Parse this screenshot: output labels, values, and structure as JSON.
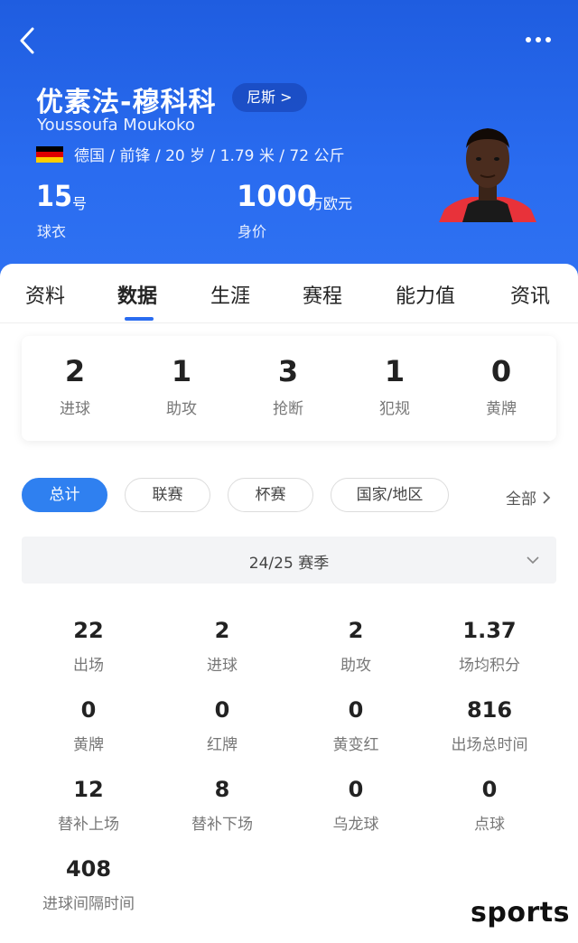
{
  "header": {
    "name_cn": "优素法-穆科科",
    "club": "尼斯 >",
    "name_en": "Youssoufa Moukoko",
    "info": "德国 / 前锋 / 20 岁 / 1.79 米 / 72 公斤",
    "jersey_number": "15",
    "jersey_unit": "号",
    "jersey_label": "球衣",
    "market_value": "1000",
    "market_value_unit": "万欧元",
    "market_value_label": "身价",
    "flag_colors": [
      "#000000",
      "#dd0000",
      "#ffce00"
    ],
    "brand_color": "#2a6cf0"
  },
  "tabs": [
    "资料",
    "数据",
    "生涯",
    "赛程",
    "能力值",
    "资讯"
  ],
  "active_tab": "数据",
  "summary": [
    {
      "value": "2",
      "label": "进球"
    },
    {
      "value": "1",
      "label": "助攻"
    },
    {
      "value": "3",
      "label": "抢断"
    },
    {
      "value": "1",
      "label": "犯规"
    },
    {
      "value": "0",
      "label": "黄牌"
    }
  ],
  "filters": [
    "总计",
    "联赛",
    "杯赛",
    "国家/地区"
  ],
  "active_filter": "总计",
  "filter_all": "全部",
  "season": "24/25 赛季",
  "stats": [
    {
      "value": "22",
      "label": "出场"
    },
    {
      "value": "2",
      "label": "进球"
    },
    {
      "value": "2",
      "label": "助攻"
    },
    {
      "value": "1.37",
      "label": "场均积分"
    },
    {
      "value": "0",
      "label": "黄牌"
    },
    {
      "value": "0",
      "label": "红牌"
    },
    {
      "value": "0",
      "label": "黄变红"
    },
    {
      "value": "816",
      "label": "出场总时间"
    },
    {
      "value": "12",
      "label": "替补上场"
    },
    {
      "value": "8",
      "label": "替补下场"
    },
    {
      "value": "0",
      "label": "乌龙球"
    },
    {
      "value": "0",
      "label": "点球"
    },
    {
      "value": "408",
      "label": "进球间隔时间"
    }
  ],
  "watermark": "sports"
}
